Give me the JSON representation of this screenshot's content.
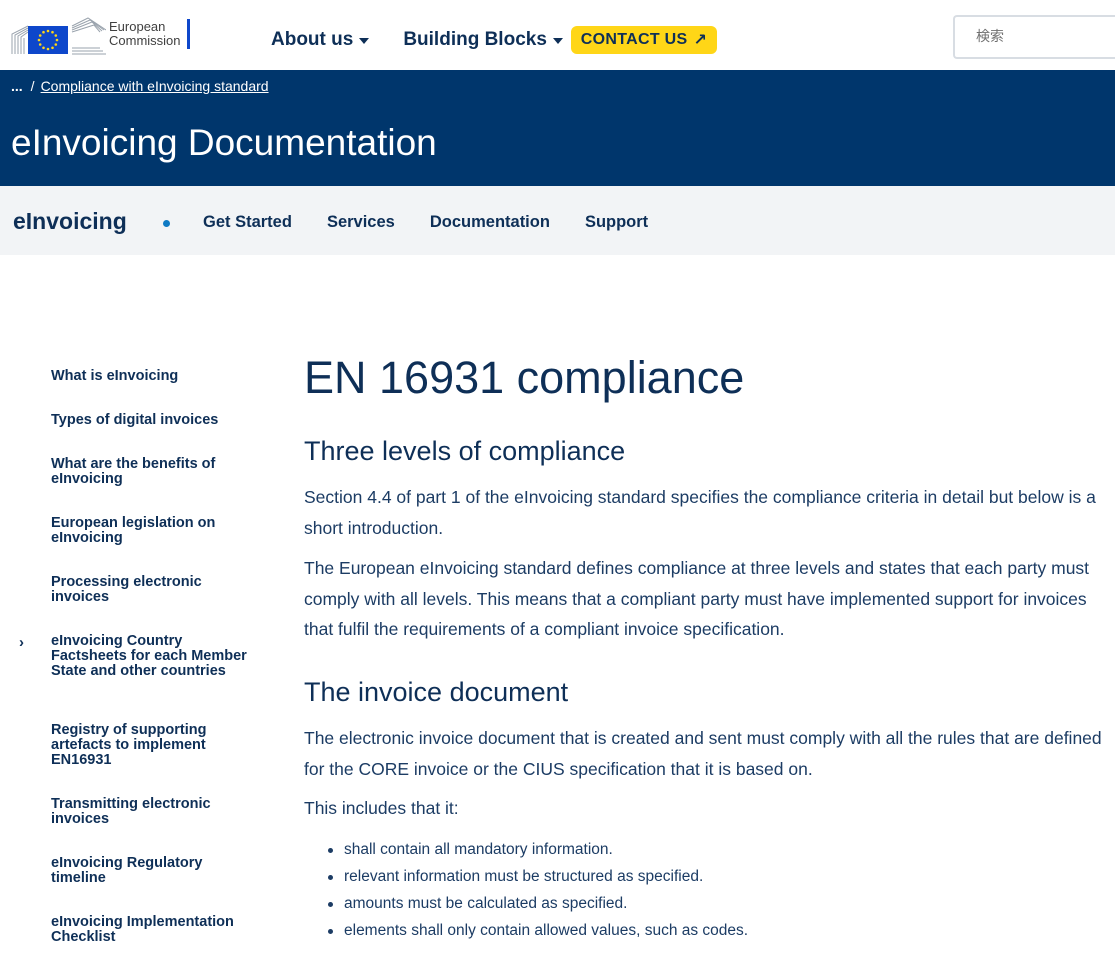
{
  "header": {
    "logo_line1": "European",
    "logo_line2": "Commission",
    "nav": [
      {
        "label": "About us"
      },
      {
        "label": "Building Blocks"
      }
    ],
    "contact_label": "CONTACT US",
    "contact_arrow": "↗",
    "search_placeholder": "検索"
  },
  "banner": {
    "breadcrumb_ellipsis": "...",
    "breadcrumb_sep": "/",
    "breadcrumb_current": "Compliance with eInvoicing standard",
    "title": "eInvoicing Documentation"
  },
  "sitenav": {
    "site_name": "eInvoicing",
    "links": [
      "Get Started",
      "Services",
      "Documentation",
      "Support"
    ]
  },
  "sidebar": {
    "items": [
      {
        "label": "What is eInvoicing"
      },
      {
        "label": "Types of digital invoices"
      },
      {
        "label": "What are the benefits of eInvoicing"
      },
      {
        "label": "European legislation on eInvoicing"
      },
      {
        "label": "Processing electronic invoices"
      },
      {
        "label": "eInvoicing Country Factsheets for each Member State and other countries",
        "chevron": "›"
      },
      {
        "label": "Registry of supporting artefacts to implement EN16931"
      },
      {
        "label": "Transmitting electronic invoices"
      },
      {
        "label": "eInvoicing Regulatory timeline"
      },
      {
        "label": "eInvoicing Implementation Checklist"
      }
    ]
  },
  "content": {
    "title": "EN 16931 compliance",
    "section1_heading": "Three levels of compliance",
    "section1_p1": "Section 4.4 of part 1 of the eInvoicing standard specifies the compliance criteria in detail but below is a short introduction.",
    "section1_p2": "The European eInvoicing standard defines compliance at three levels and states that each party must comply with all levels. This means that a compliant party must have implemented support for invoices that fulfil the requirements of a compliant invoice specification.",
    "section2_heading": "The invoice document",
    "section2_p1": "The electronic invoice document that is created and sent must comply with all the rules that are defined for the CORE invoice or the CIUS specification that it is based on.",
    "section2_p2": "This includes that it:",
    "bullets": [
      "shall contain all mandatory information.",
      "relevant information must be structured as specified.",
      "amounts must be calculated as specified.",
      "elements shall only contain allowed values, such as codes."
    ]
  },
  "colors": {
    "banner": "#00366c",
    "accent_yellow": "#ffd617",
    "text_navy": "#0e2f57",
    "nav_bg": "#f2f4f6"
  }
}
